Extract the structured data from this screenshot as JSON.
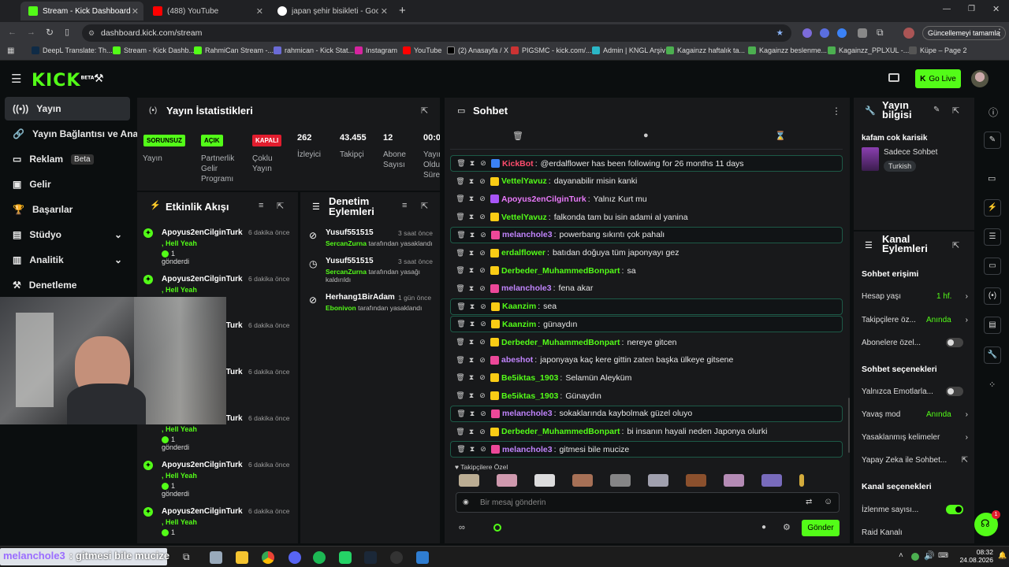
{
  "browser": {
    "tabs": [
      {
        "title": "Stream - Kick Dashboard"
      },
      {
        "title": "(488) YouTube"
      },
      {
        "title": "japan şehir bisikleti - Google'da"
      }
    ],
    "url": "dashboard.kick.com/stream",
    "update_button": "Güncellemeyi tamamla",
    "bookmarks": [
      "DeepL Translate: Th...",
      "Stream - Kick Dashb...",
      "RahmiCan Stream -...",
      "rahmican - Kick Stat...",
      "Instagram",
      "YouTube",
      "(2) Anasayfa / X",
      "PIGSMC - kick.com/...",
      "Admin | KNGL Arşiv",
      "Kagainzz haftalık ta...",
      "Kagainzz beslenme...",
      "Kagainzz_PPLXUL -...",
      "Küpe – Page 2"
    ]
  },
  "header": {
    "logo": "KICK",
    "logo_sup": "BETA",
    "go_live": "Go Live"
  },
  "sidebar": {
    "items": [
      {
        "label": "Yayın",
        "icon": "broadcast-icon"
      },
      {
        "label": "Yayın Bağlantısı ve Anahtar",
        "icon": "link-icon"
      },
      {
        "label": "Reklam",
        "badge": "Beta",
        "icon": "ad-icon"
      },
      {
        "label": "Gelir",
        "icon": "wallet-icon"
      },
      {
        "label": "Başarılar",
        "icon": "trophy-icon"
      },
      {
        "label": "Stüdyo",
        "icon": "studio-icon"
      },
      {
        "label": "Analitik",
        "icon": "chart-icon"
      },
      {
        "label": "Denetleme",
        "icon": "hammer-icon"
      }
    ]
  },
  "stats": {
    "title": "Yayın İstatistikleri",
    "cols": [
      {
        "value": "SORUNSUZ",
        "label": "Yayın"
      },
      {
        "value": "AÇIK",
        "label": "Partnerlik Gelir Programı"
      },
      {
        "value": "KAPALI",
        "label": "Çoklu Yayın"
      },
      {
        "value": "262",
        "label": "İzleyici"
      },
      {
        "value": "43.455",
        "label": "Takipçi"
      },
      {
        "value": "12",
        "label": "Abone Sayısı"
      },
      {
        "value": "00:0",
        "label": "Yayın Oldu Süre"
      }
    ]
  },
  "activity": {
    "title": "Etkinlik Akışı",
    "items": [
      {
        "user": "Apoyus2enCilginTurk",
        "time": "6 dakika önce",
        "sub": ", Hell Yeah",
        "amount": "1",
        "sent": "gönderdi"
      },
      {
        "user": "Apoyus2enCilginTurk",
        "time": "6 dakika önce",
        "sub": ", Hell Yeah",
        "amount": "",
        "sent": ""
      },
      {
        "user": "Apoyus2enCilginTurk",
        "time": "6 dakika önce",
        "sub": "",
        "amount": "",
        "sent": ""
      },
      {
        "user": "Apoyus2enCilginTurk",
        "time": "6 dakika önce",
        "sub": "",
        "amount": "",
        "sent": ""
      },
      {
        "user": "Apoyus2enCilginTurk",
        "time": "6 dakika önce",
        "sub": ", Hell Yeah",
        "amount": "1",
        "sent": "gönderdi"
      },
      {
        "user": "Apoyus2enCilginTurk",
        "time": "6 dakika önce",
        "sub": ", Hell Yeah",
        "amount": "1",
        "sent": "gönderdi"
      },
      {
        "user": "Apoyus2enCilginTurk",
        "time": "6 dakika önce",
        "sub": ", Hell Yeah",
        "amount": "1",
        "sent": ""
      }
    ]
  },
  "moderation": {
    "title": "Denetim Eylemleri",
    "items": [
      {
        "user": "Yusuf551515",
        "time": "3 saat önce",
        "by": "SercanZurna",
        "action": "tarafından yasaklandı"
      },
      {
        "user": "Yusuf551515",
        "time": "3 saat önce",
        "by": "SercanZurna",
        "action": "tarafından yasağı kaldırıldı"
      },
      {
        "user": "Herhang1BirAdam",
        "time": "1 gün önce",
        "by": "Ebonivon",
        "action": "tarafından yasaklandı"
      }
    ]
  },
  "chat": {
    "title": "Sohbet",
    "messages": [
      {
        "user": "KickBot",
        "color": "#ff4d6d",
        "text": "@erdalflower has been following for 26 months 11 days",
        "hl": true
      },
      {
        "user": "VettelYavuz",
        "color": "#53fc18",
        "text": "dayanabilir misin kanki",
        "hl": false
      },
      {
        "user": "Apoyus2enCilginTurk",
        "color": "#e879f9",
        "text": "Yalnız Kurt mu",
        "hl": false
      },
      {
        "user": "VettelYavuz",
        "color": "#53fc18",
        "text": "falkonda tam bu isin adami al yanina",
        "hl": false
      },
      {
        "user": "melanchole3",
        "color": "#c084fc",
        "text": "powerbang sıkıntı çok pahalı",
        "hl": true
      },
      {
        "user": "erdalflower",
        "color": "#53fc18",
        "text": "batıdan doğuya tüm japonyayı gez",
        "hl": false
      },
      {
        "user": "Derbeder_MuhammedBonpart",
        "color": "#53fc18",
        "text": "sa",
        "hl": false
      },
      {
        "user": "melanchole3",
        "color": "#c084fc",
        "text": "fena akar",
        "hl": false
      },
      {
        "user": "Kaanzim",
        "color": "#53fc18",
        "text": "sea",
        "hl": true
      },
      {
        "user": "Kaanzim",
        "color": "#53fc18",
        "text": "günaydın",
        "hl": true
      },
      {
        "user": "Derbeder_MuhammedBonpart",
        "color": "#53fc18",
        "text": "nereye gitcen",
        "hl": false
      },
      {
        "user": "abeshot",
        "color": "#c084fc",
        "text": "japonyaya kaç kere gittin zaten başka ülkeye gitsene",
        "hl": false
      },
      {
        "user": "Be5iktas_1903",
        "color": "#53fc18",
        "text": "Selamün Aleyküm",
        "hl": false
      },
      {
        "user": "Be5iktas_1903",
        "color": "#53fc18",
        "text": "Günaydın",
        "hl": false
      },
      {
        "user": "melanchole3",
        "color": "#c084fc",
        "text": "sokaklarında kaybolmak güzel oluyo",
        "hl": true
      },
      {
        "user": "Derbeder_MuhammedBonpart",
        "color": "#53fc18",
        "text": "bi insanın hayali neden Japonya olurki",
        "hl": false
      },
      {
        "user": "melanchole3",
        "color": "#c084fc",
        "text": "gitmesi bile mucize",
        "hl": true
      }
    ],
    "emote_section": "Takipçilere Özel",
    "input_placeholder": "Bir mesaj gönderin",
    "send": "Gönder"
  },
  "stream_info": {
    "title": "Yayın bilgisi",
    "stream_title": "kafam cok karisik",
    "category": "Sadece Sohbet",
    "tag": "Turkish"
  },
  "channel_actions": {
    "title": "Kanal Eylemleri",
    "chat_access": "Sohbet erişimi",
    "account_age": {
      "label": "Hesap yaşı",
      "value": "1 hf."
    },
    "followers_only": {
      "label": "Takipçilere öz...",
      "value": "Anında"
    },
    "subscribers_only": {
      "label": "Abonelere özel..."
    },
    "chat_options": "Sohbet seçenekleri",
    "emote_only": {
      "label": "Yalnızca Emotlarla..."
    },
    "slow_mode": {
      "label": "Yavaş mod",
      "value": "Anında"
    },
    "banned_words": {
      "label": "Yasaklanmış kelimeler"
    },
    "ai_chat": {
      "label": "Yapay Zeka ile Sohbet..."
    },
    "channel_options": "Kanal seçenekleri",
    "view_count": {
      "label": "İzlenme sayısı..."
    },
    "raid": {
      "label": "Raid Kanalı"
    }
  },
  "webcam_caption": {
    "user": "melanchole3",
    "text": ": gitmesi bile mucize"
  },
  "taskbar": {
    "time": "08:32",
    "date": "24.08.2026"
  },
  "colors": {
    "accent": "#53fc18",
    "panel": "#18191b",
    "bg": "#0b0e0f"
  }
}
